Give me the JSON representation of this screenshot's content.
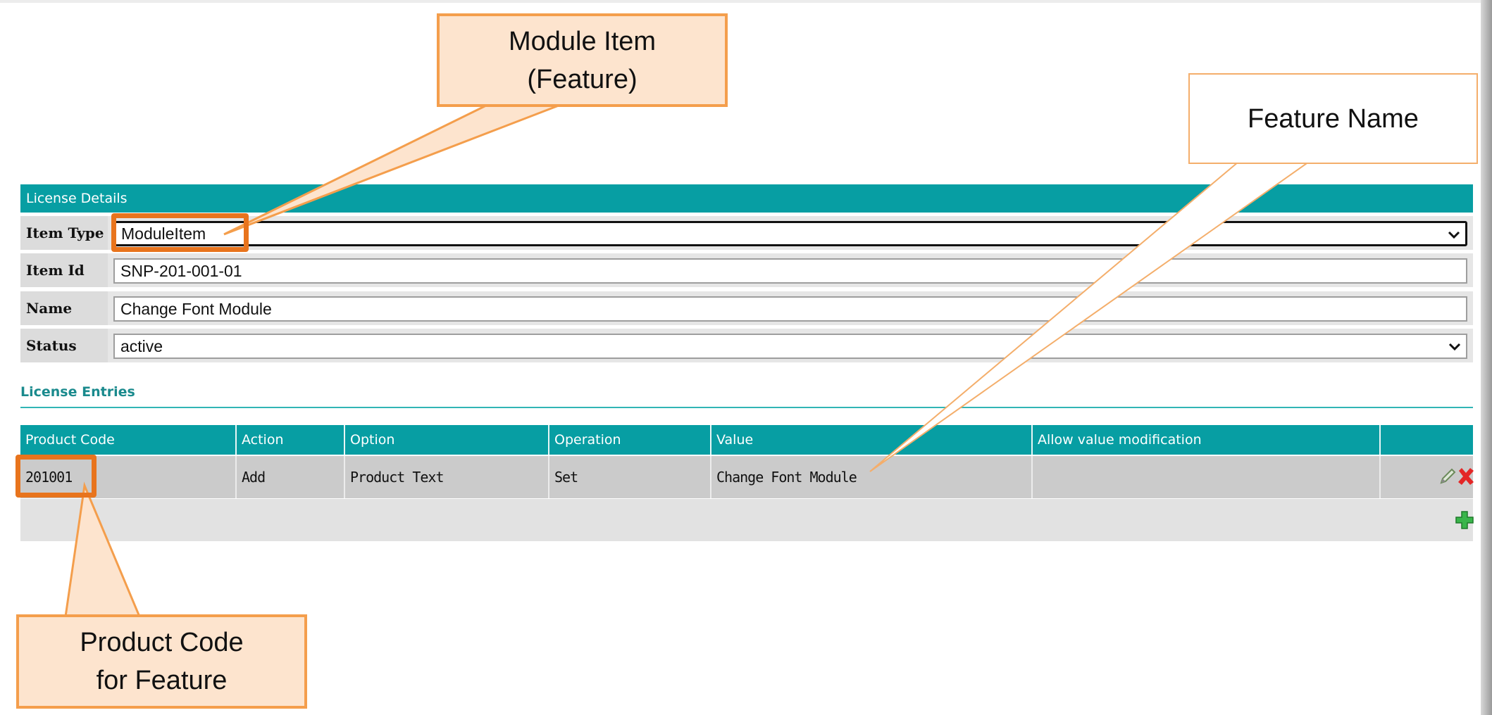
{
  "license_details": {
    "header": "License Details",
    "fields": [
      {
        "label": "Item Type",
        "value": "ModuleItem"
      },
      {
        "label": "Item Id",
        "value": "SNP-201-001-01"
      },
      {
        "label": "Name",
        "value": "Change Font Module"
      },
      {
        "label": "Status",
        "value": "active"
      }
    ]
  },
  "license_entries": {
    "title": "License Entries",
    "columns": [
      "Product Code",
      "Action",
      "Option",
      "Operation",
      "Value",
      "Allow value modification",
      ""
    ],
    "rows": [
      {
        "product_code": "201001",
        "action": "Add",
        "option": "Product Text",
        "operation": "Set",
        "value": "Change Font Module",
        "allow_value_modification": ""
      }
    ]
  },
  "callouts": {
    "module_item": [
      "Module Item",
      "(Feature)"
    ],
    "feature_name": "Feature Name",
    "product_code": [
      "Product Code",
      "for Feature"
    ]
  },
  "icons": {
    "edit": "pencil-icon",
    "delete": "close-icon",
    "add": "plus-icon"
  },
  "colors": {
    "header_teal": "#079ea3",
    "callout_fill": "#fde4ce",
    "callout_border": "#f49e4c",
    "highlight": "#e8741d"
  }
}
